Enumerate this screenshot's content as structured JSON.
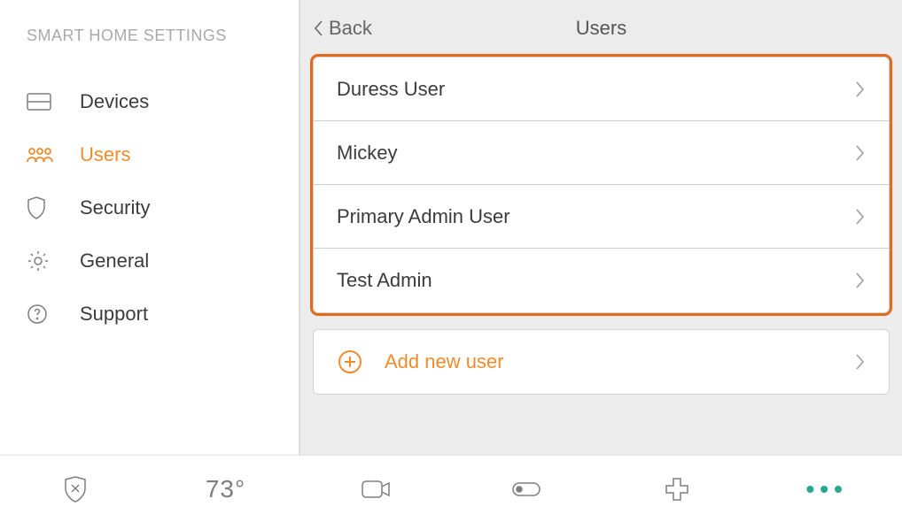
{
  "sidebar": {
    "title": "SMART HOME SETTINGS",
    "items": [
      {
        "label": "Devices"
      },
      {
        "label": "Users"
      },
      {
        "label": "Security"
      },
      {
        "label": "General"
      },
      {
        "label": "Support"
      }
    ],
    "active_index": 1
  },
  "header": {
    "back_label": "Back",
    "title": "Users"
  },
  "users": [
    {
      "name": "Duress User"
    },
    {
      "name": "Mickey"
    },
    {
      "name": "Primary Admin User"
    },
    {
      "name": "Test Admin"
    }
  ],
  "add_user_label": "Add new user",
  "footer": {
    "temperature": "73°"
  }
}
